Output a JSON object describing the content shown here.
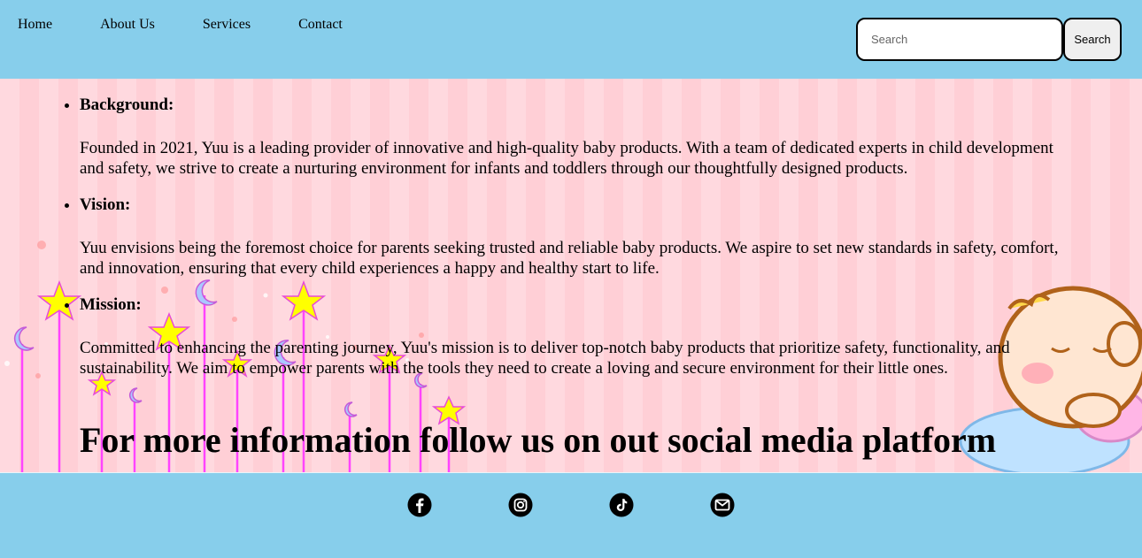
{
  "header": {
    "nav": [
      "Home",
      "About Us",
      "Services",
      "Contact"
    ],
    "search": {
      "placeholder": "Search",
      "button_label": "Search"
    }
  },
  "main": {
    "sections": [
      {
        "heading": "Background:",
        "text": "Founded in 2021, Yuu is a leading provider of innovative and high-quality baby products. With a team of dedicated experts in child development and safety, we strive to create a nurturing environment for infants and toddlers through our thoughtfully designed products."
      },
      {
        "heading": "Vision:",
        "text": "Yuu envisions being the foremost choice for parents seeking trusted and reliable baby products. We aspire to set new standards in safety, comfort, and innovation, ensuring that every child experiences a happy and healthy start to life."
      },
      {
        "heading": "Mission:",
        "text": "Committed to enhancing the parenting journey, Yuu's mission is to deliver top-notch baby products that prioritize safety, functionality, and sustainability. We aim to empower parents with the tools they need to create a loving and secure environment for their little ones."
      }
    ],
    "follow_title": "For more information follow us on out social media platform"
  },
  "footer": {
    "social_icons": [
      "facebook-icon",
      "instagram-icon",
      "tiktok-icon",
      "email-icon"
    ]
  },
  "colors": {
    "header_bg": "#87ceeb",
    "pink_bg": "#ffd9df",
    "star": "#ffff00",
    "moon": "#aac8ff",
    "stem": "#ff44ff"
  }
}
